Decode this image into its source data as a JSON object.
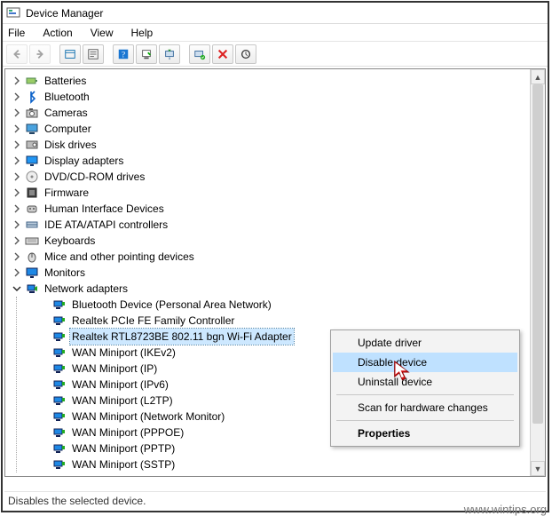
{
  "window": {
    "title": "Device Manager"
  },
  "menubar": {
    "items": [
      "File",
      "Action",
      "View",
      "Help"
    ]
  },
  "toolbar": {
    "buttons": [
      {
        "name": "back-icon",
        "interact": true,
        "disabled": true
      },
      {
        "name": "forward-icon",
        "interact": true,
        "disabled": true
      },
      {
        "name": "sep"
      },
      {
        "name": "show-hidden-icon",
        "interact": true
      },
      {
        "name": "properties-icon",
        "interact": true
      },
      {
        "name": "sep"
      },
      {
        "name": "help-icon",
        "interact": true
      },
      {
        "name": "scan-hardware-icon",
        "interact": true
      },
      {
        "name": "update-driver-icon",
        "interact": true
      },
      {
        "name": "sep"
      },
      {
        "name": "enable-device-icon",
        "interact": true
      },
      {
        "name": "disable-device-icon",
        "interact": true
      },
      {
        "name": "uninstall-device-icon",
        "interact": true
      }
    ]
  },
  "tree": {
    "categories": [
      {
        "label": "Batteries",
        "icon": "battery-icon",
        "expanded": false
      },
      {
        "label": "Bluetooth",
        "icon": "bluetooth-icon",
        "expanded": false
      },
      {
        "label": "Cameras",
        "icon": "camera-icon",
        "expanded": false
      },
      {
        "label": "Computer",
        "icon": "computer-icon",
        "expanded": false
      },
      {
        "label": "Disk drives",
        "icon": "disk-icon",
        "expanded": false
      },
      {
        "label": "Display adapters",
        "icon": "display-icon",
        "expanded": false
      },
      {
        "label": "DVD/CD-ROM drives",
        "icon": "dvd-icon",
        "expanded": false
      },
      {
        "label": "Firmware",
        "icon": "firmware-icon",
        "expanded": false
      },
      {
        "label": "Human Interface Devices",
        "icon": "hid-icon",
        "expanded": false
      },
      {
        "label": "IDE ATA/ATAPI controllers",
        "icon": "ide-icon",
        "expanded": false
      },
      {
        "label": "Keyboards",
        "icon": "keyboard-icon",
        "expanded": false
      },
      {
        "label": "Mice and other pointing devices",
        "icon": "mouse-icon",
        "expanded": false
      },
      {
        "label": "Monitors",
        "icon": "monitor-icon",
        "expanded": false
      },
      {
        "label": "Network adapters",
        "icon": "network-icon",
        "expanded": true
      }
    ],
    "network_children": [
      {
        "label": "Bluetooth Device (Personal Area Network)",
        "selected": false
      },
      {
        "label": "Realtek PCIe FE Family Controller",
        "selected": false
      },
      {
        "label": "Realtek RTL8723BE 802.11 bgn Wi-Fi Adapter",
        "selected": true
      },
      {
        "label": "WAN Miniport (IKEv2)",
        "selected": false
      },
      {
        "label": "WAN Miniport (IP)",
        "selected": false
      },
      {
        "label": "WAN Miniport (IPv6)",
        "selected": false
      },
      {
        "label": "WAN Miniport (L2TP)",
        "selected": false
      },
      {
        "label": "WAN Miniport (Network Monitor)",
        "selected": false
      },
      {
        "label": "WAN Miniport (PPPOE)",
        "selected": false
      },
      {
        "label": "WAN Miniport (PPTP)",
        "selected": false
      },
      {
        "label": "WAN Miniport (SSTP)",
        "selected": false
      }
    ]
  },
  "context_menu": {
    "items": [
      {
        "label": "Update driver",
        "hl": false
      },
      {
        "label": "Disable device",
        "hl": true
      },
      {
        "label": "Uninstall device",
        "hl": false
      },
      {
        "sep": true
      },
      {
        "label": "Scan for hardware changes",
        "hl": false
      },
      {
        "sep": true
      },
      {
        "label": "Properties",
        "hl": false,
        "bold": true
      }
    ]
  },
  "statusbar": {
    "text": "Disables the selected device."
  },
  "watermark": "www.wintips.org"
}
